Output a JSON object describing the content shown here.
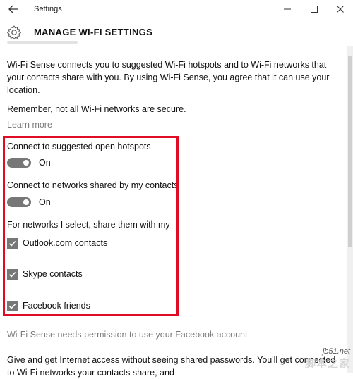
{
  "window": {
    "title": "Settings",
    "back_icon": "back-arrow-icon",
    "minimize_icon": "minimize-icon",
    "maximize_icon": "maximize-icon",
    "close_icon": "close-icon"
  },
  "header": {
    "icon": "gear-icon",
    "title": "MANAGE WI-FI SETTINGS"
  },
  "content": {
    "intro": "Wi-Fi Sense connects you to suggested Wi-Fi hotspots and to Wi-Fi networks that your contacts share with you. By using Wi-Fi Sense, you agree that it can use your location.",
    "warning": "Remember, not all Wi-Fi networks are secure.",
    "learn_more": "Learn more",
    "suggested_hotspots": {
      "label": "Connect to suggested open hotspots",
      "state": "On"
    },
    "shared_networks": {
      "label": "Connect to networks shared by my contacts",
      "state": "On"
    },
    "share_label": "For networks I select, share them with my",
    "share_options": [
      {
        "label": "Outlook.com contacts",
        "checked": true
      },
      {
        "label": "Skype contacts",
        "checked": true
      },
      {
        "label": "Facebook friends",
        "checked": true
      }
    ],
    "facebook_permission": "Wi-Fi Sense needs permission to use your Facebook account",
    "bottom_text": "Give and get Internet access without seeing shared passwords. You'll get connected to Wi-Fi networks your contacts share, and"
  },
  "watermark": {
    "url": "jb51.net",
    "text": "脚本之家"
  },
  "colors": {
    "annotation_red": "#e00b25",
    "toggle_on": "#777777",
    "muted_text": "#7a7a7a"
  }
}
